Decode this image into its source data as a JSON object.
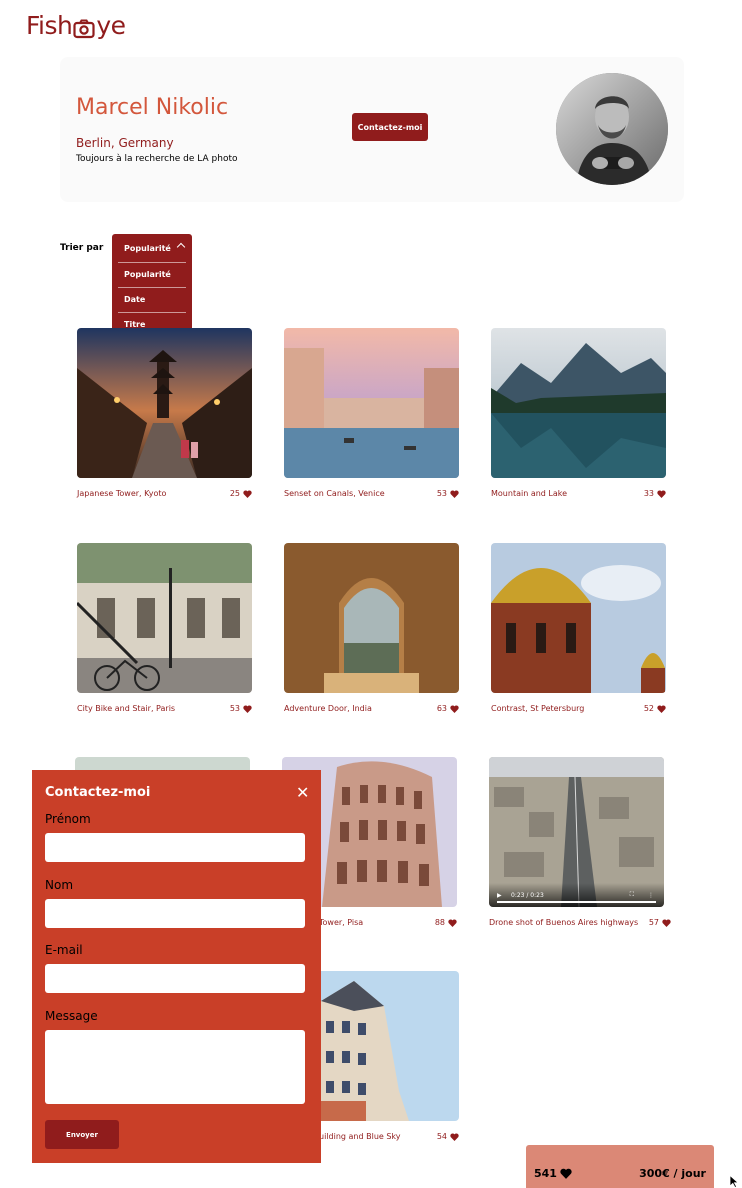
{
  "brand": {
    "logo_left": "Fish",
    "logo_right": "ye",
    "accent": "#901C1C",
    "secondary": "#D3573C"
  },
  "photographer": {
    "name": "Marcel Nikolic",
    "location": "Berlin, Germany",
    "tagline": "Toujours à la recherche de LA photo",
    "contact_label": "Contactez-moi"
  },
  "sort": {
    "label": "Trier par",
    "selected": "Popularité",
    "options": [
      "Popularité",
      "Date",
      "Titre"
    ]
  },
  "media": [
    {
      "title": "Japanese Tower, Kyoto",
      "likes": "25"
    },
    {
      "title": "Senset on Canals, Venice",
      "likes": "53"
    },
    {
      "title": "Mountain and Lake",
      "likes": "33"
    },
    {
      "title": "City Bike and Stair, Paris",
      "likes": "53"
    },
    {
      "title": "Adventure Door, India",
      "likes": "63"
    },
    {
      "title": "Contrast, St Petersburg",
      "likes": "52"
    },
    {
      "title": "Tower, Pisa",
      "likes": "88"
    },
    {
      "title": "Drone shot of Buenos Aires highways",
      "likes": "57",
      "video_time": "0:23 / 0:23"
    },
    {
      "title": "uilding and Blue Sky",
      "likes": "54"
    }
  ],
  "modal": {
    "title": "Contactez-moi",
    "close": "✕",
    "first_name_label": "Prénom",
    "last_name_label": "Nom",
    "email_label": "E-mail",
    "message_label": "Message",
    "submit_label": "Envoyer"
  },
  "totals": {
    "likes": "541",
    "rate": "300€ / jour"
  }
}
